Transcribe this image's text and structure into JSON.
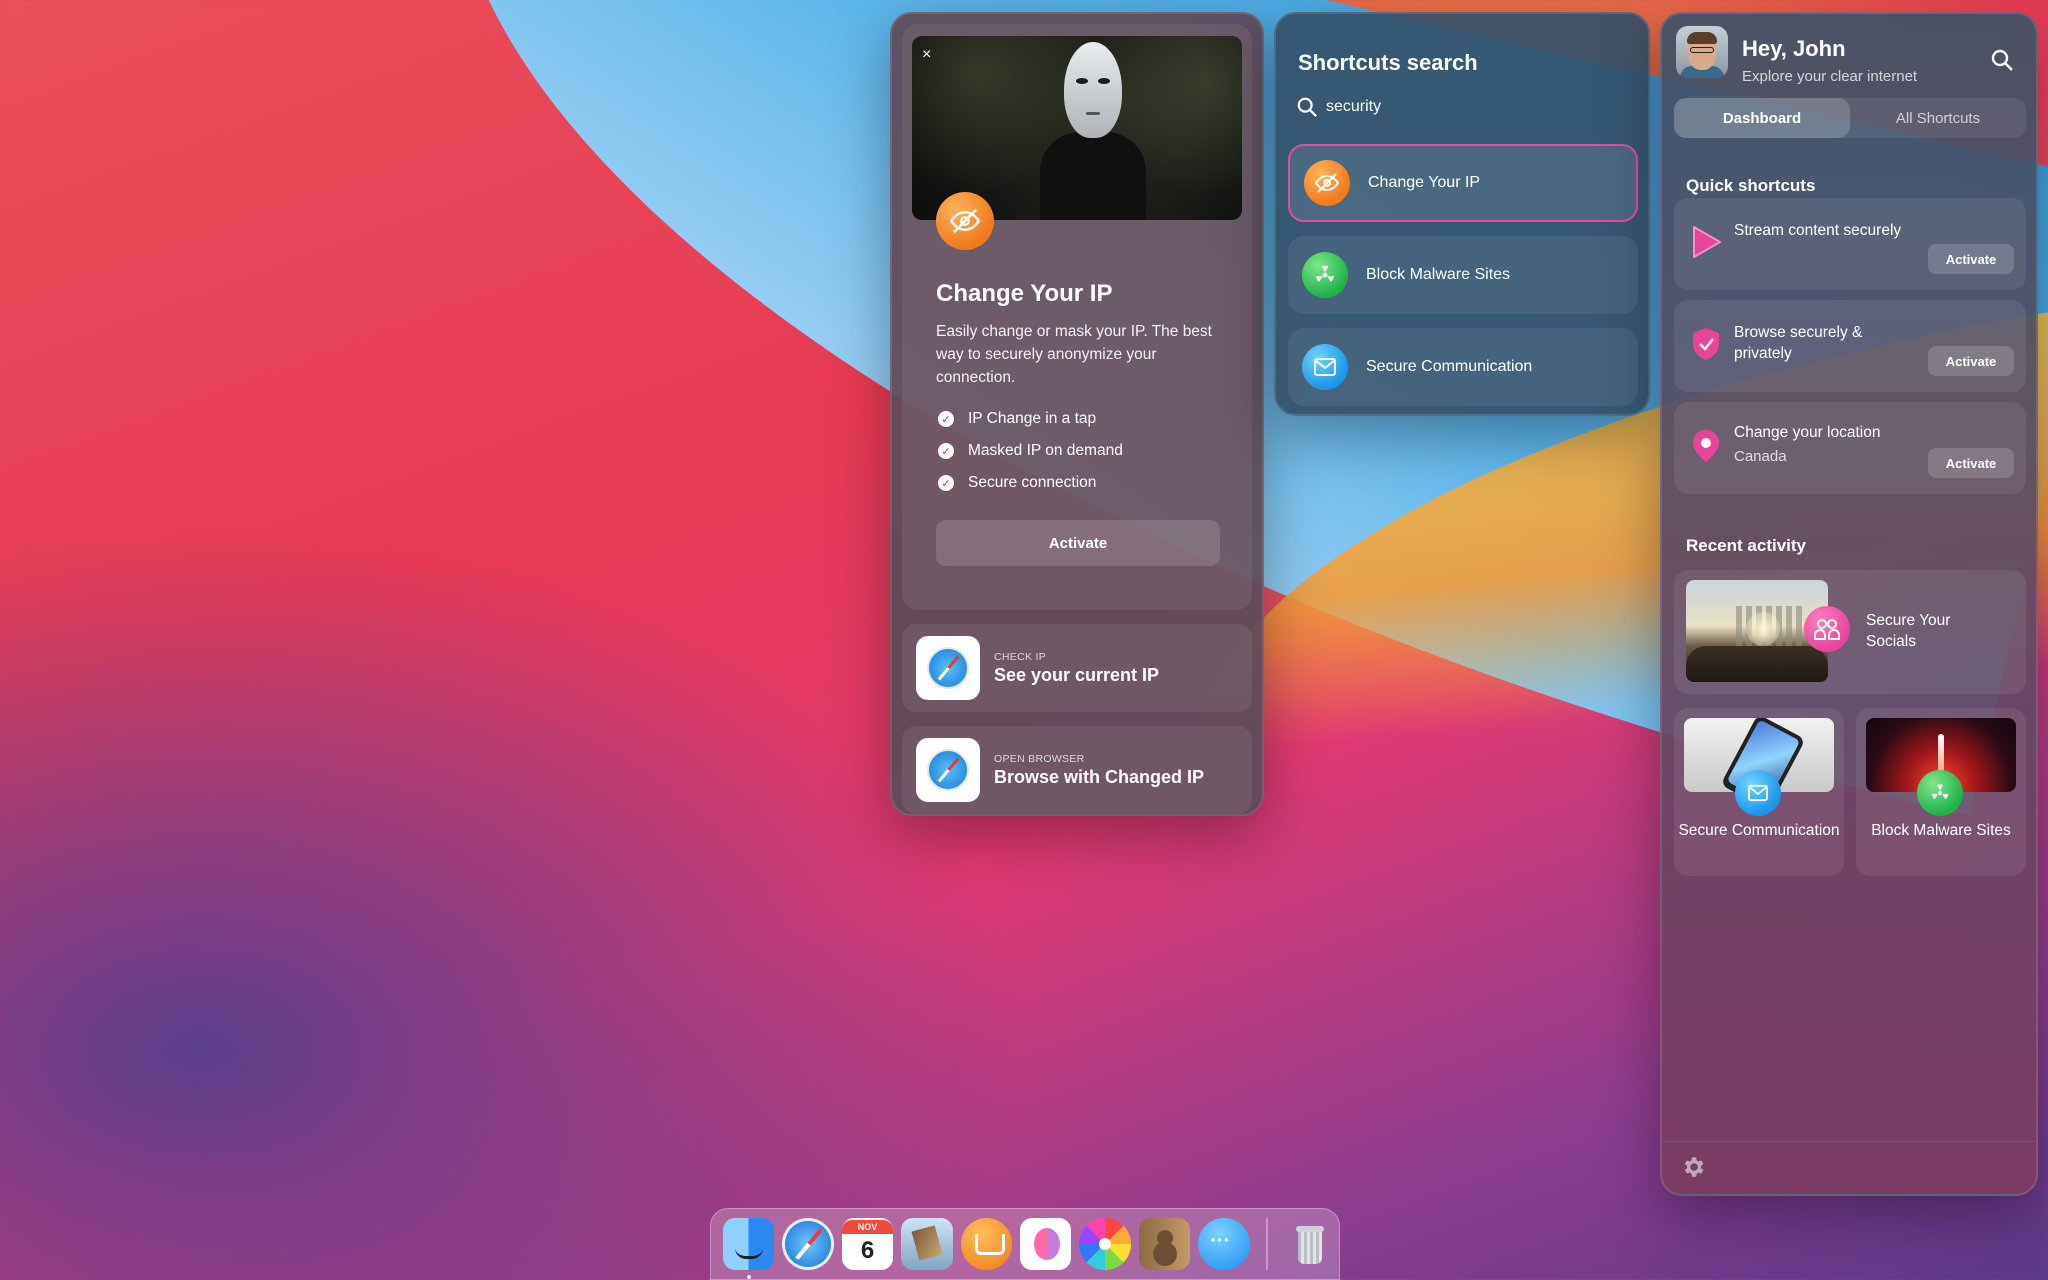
{
  "detail": {
    "close_label": "×",
    "icon": "eye-slash-icon",
    "title": "Change Your IP",
    "description": "Easily change or mask your IP. The best way to securely anonymize your connection.",
    "features": [
      "IP Change in a tap",
      "Masked IP on demand",
      "Secure connection"
    ],
    "activate_label": "Activate",
    "links": [
      {
        "kicker": "CHECK IP",
        "title": "See your current IP",
        "icon": "safari-compass-icon"
      },
      {
        "kicker": "OPEN BROWSER",
        "title": "Browse with Changed IP",
        "icon": "safari-compass-icon"
      }
    ]
  },
  "search": {
    "title": "Shortcuts search",
    "query": "security",
    "results": [
      {
        "label": "Change Your IP",
        "icon": "eye-slash-icon",
        "color": "#f07a1c",
        "active": true
      },
      {
        "label": "Block Malware Sites",
        "icon": "radiation-icon",
        "color": "#21b14a",
        "active": false
      },
      {
        "label": "Secure Communication",
        "icon": "envelope-icon",
        "color": "#1c96e8",
        "active": false
      }
    ]
  },
  "dashboard": {
    "greeting": "Hey, John",
    "subtitle": "Explore your clear internet",
    "tabs": [
      {
        "label": "Dashboard",
        "active": true
      },
      {
        "label": "All Shortcuts",
        "active": false
      }
    ],
    "quick_title": "Quick shortcuts",
    "quick": [
      {
        "label": "Stream content securely",
        "sub": "",
        "icon": "play-icon",
        "button": "Activate"
      },
      {
        "label": "Browse securely & privately",
        "sub": "",
        "icon": "shield-check-icon",
        "button": "Activate"
      },
      {
        "label": "Change your location",
        "sub": "Canada",
        "icon": "location-pin-icon",
        "button": "Activate"
      }
    ],
    "recent_title": "Recent activity",
    "recent_big": {
      "label": "Secure Your Socials",
      "icon": "people-icon"
    },
    "recent_tiles": [
      {
        "label": "Secure Communication",
        "icon": "envelope-icon"
      },
      {
        "label": "Block Malware Sites",
        "icon": "radiation-icon"
      }
    ],
    "settings_icon": "gear-icon"
  },
  "dock": {
    "calendar_month": "NOV",
    "calendar_day": "6",
    "apps": [
      "finder-icon",
      "safari-icon",
      "calendar-icon",
      "preview-icon",
      "books-icon",
      "app-icon",
      "photos-icon",
      "contacts-icon",
      "messages-icon",
      "trash-icon"
    ]
  },
  "colors": {
    "accent_pink": "#e24c9a",
    "orange": "#f07a1c",
    "green": "#21b14a",
    "blue": "#1c96e8"
  }
}
